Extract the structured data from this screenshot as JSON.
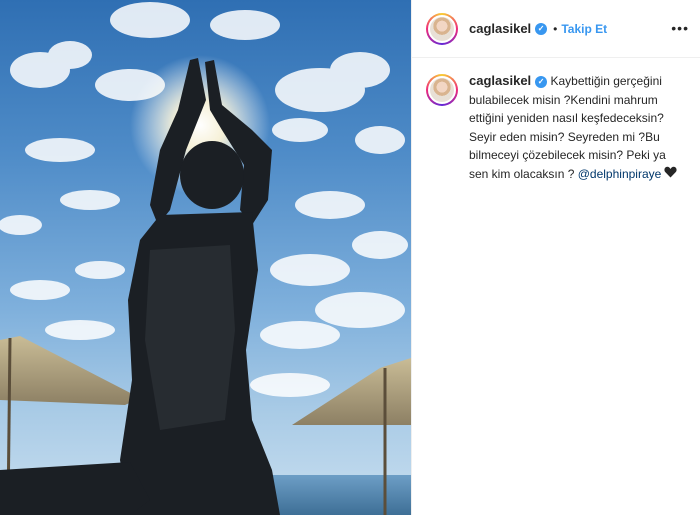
{
  "post": {
    "author": {
      "username": "caglasikel",
      "verified_icon": "verified-badge-icon",
      "follow_label": "Takip Et",
      "separator": "•"
    },
    "more_label": "•••",
    "caption": {
      "username": "caglasikel",
      "text": "Kaybettiğin gerçeğini bulabilecek misin ?Kendini mahrum ettiğini yeniden nasıl keşfedeceksin? Seyir eden misin? Seyreden mi ?Bu bilmeceyi çözebilecek misin? Peki ya sen kim olacaksın ?",
      "mention": "@delphinpiraye",
      "emoji_icon": "black-heart-icon"
    },
    "colors": {
      "link_blue": "#3897f0",
      "mention_blue": "#00376b",
      "text": "#262626",
      "sky": "#4f8cc8"
    }
  }
}
